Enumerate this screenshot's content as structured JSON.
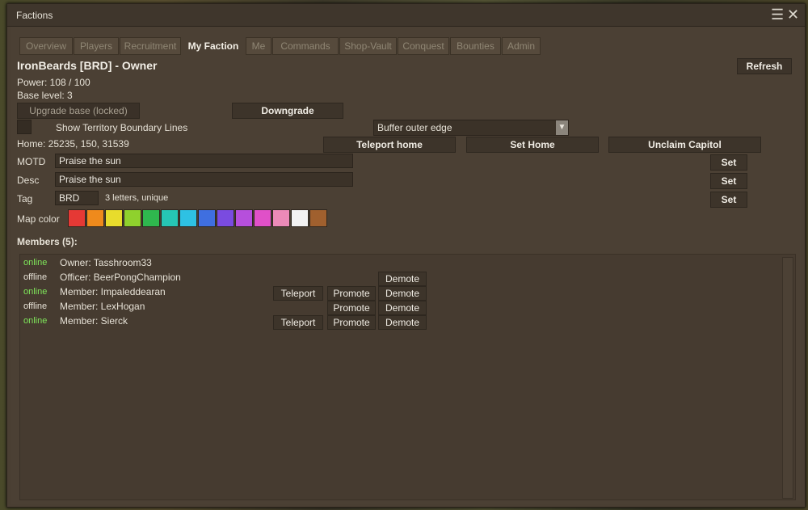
{
  "window": {
    "title": "Factions"
  },
  "tabs": [
    {
      "label": "Overview"
    },
    {
      "label": "Players"
    },
    {
      "label": "Recruitment"
    },
    {
      "label": "My Faction"
    },
    {
      "label": "Me"
    },
    {
      "label": "Commands"
    },
    {
      "label": "Shop-Vault"
    },
    {
      "label": "Conquest"
    },
    {
      "label": "Bounties"
    },
    {
      "label": "Admin"
    }
  ],
  "faction": {
    "heading": "IronBeards [BRD] - Owner",
    "refresh": "Refresh",
    "power": "Power: 108 / 100",
    "base_level": "Base level: 3",
    "upgrade": "Upgrade base (locked)",
    "downgrade": "Downgrade",
    "show_territory": "Show Territory Boundary Lines",
    "buffer_select": "Buffer outer edge",
    "home": "Home: 25235, 150, 31539",
    "teleport_home": "Teleport home",
    "set_home": "Set Home",
    "unclaim": "Unclaim Capitol",
    "motd_label": "MOTD",
    "motd_value": "Praise the sun",
    "desc_label": "Desc",
    "desc_value": "Praise the sun",
    "tag_label": "Tag",
    "tag_value": "BRD",
    "tag_hint": "3 letters, unique",
    "set": "Set",
    "map_color_label": "Map color"
  },
  "map_colors": [
    "#e53935",
    "#ef8a1c",
    "#e8dc2c",
    "#8fd12d",
    "#2fb84e",
    "#26c6b4",
    "#2ec1e3",
    "#3f6fe0",
    "#7a4be0",
    "#b64fdc",
    "#e050c8",
    "#ec8ab8",
    "#f2f2f2",
    "#a0602e"
  ],
  "members": {
    "header": "Members (5):",
    "rows": [
      {
        "status": "online",
        "name": "Owner: Tasshroom33",
        "teleport": null,
        "promote": null,
        "demote": null
      },
      {
        "status": "offline",
        "name": "Officer: BeerPongChampion",
        "teleport": null,
        "promote": null,
        "demote": "Demote"
      },
      {
        "status": "online",
        "name": "Member: Impaleddearan",
        "teleport": "Teleport",
        "promote": "Promote",
        "demote": "Demote"
      },
      {
        "status": "offline",
        "name": "Member: LexHogan",
        "teleport": null,
        "promote": "Promote",
        "demote": "Demote"
      },
      {
        "status": "online",
        "name": "Member: Sierck",
        "teleport": "Teleport",
        "promote": "Promote",
        "demote": "Demote"
      }
    ]
  }
}
